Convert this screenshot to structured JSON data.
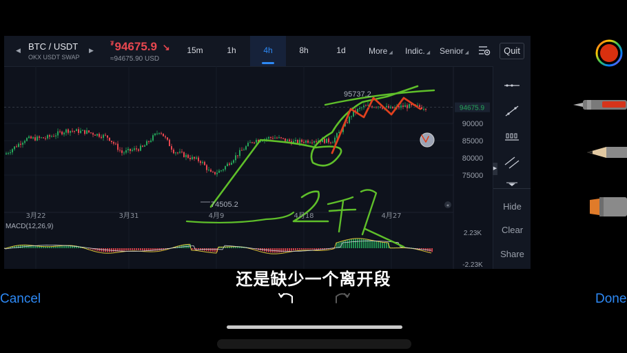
{
  "header": {
    "pair": "BTC / USDT",
    "subpair": "OKX USDT SWAP",
    "price_currency_symbol": "₮",
    "price": "94675.9",
    "price_arrow": "↘",
    "price_usd": "≈94675.90 USD",
    "prev_arrow": "◀",
    "next_arrow": "▶"
  },
  "timeframes": [
    {
      "label": "15m",
      "active": false
    },
    {
      "label": "1h",
      "active": false
    },
    {
      "label": "4h",
      "active": true
    },
    {
      "label": "8h",
      "active": false
    },
    {
      "label": "1d",
      "active": false
    }
  ],
  "menus": {
    "more": "More",
    "indic": "Indic.",
    "senior": "Senior",
    "quit": "Quit"
  },
  "chart": {
    "price_ticks": [
      "90000",
      "85000",
      "80000",
      "75000"
    ],
    "current_price_tag": "94675.9",
    "high_label": "95737.2",
    "low_label": "74505.2",
    "date_ticks": [
      "3月22",
      "3月31",
      "4月9",
      "4月18",
      "4月27"
    ],
    "macd_label": "MACD(12,26,9)",
    "macd_ticks": [
      "2.23K",
      "-2.23K"
    ]
  },
  "side_panel": {
    "hide": "Hide",
    "clear": "Clear",
    "share": "Share"
  },
  "subtitle": "还是缺少一个离开段",
  "markup_toolbar": {
    "cancel": "Cancel",
    "done": "Done"
  },
  "colors": {
    "up": "#26a65b",
    "down": "#e8474f",
    "accent": "#2d89f5",
    "annotation_green": "#5fbf2a",
    "annotation_red": "#e0401e"
  }
}
